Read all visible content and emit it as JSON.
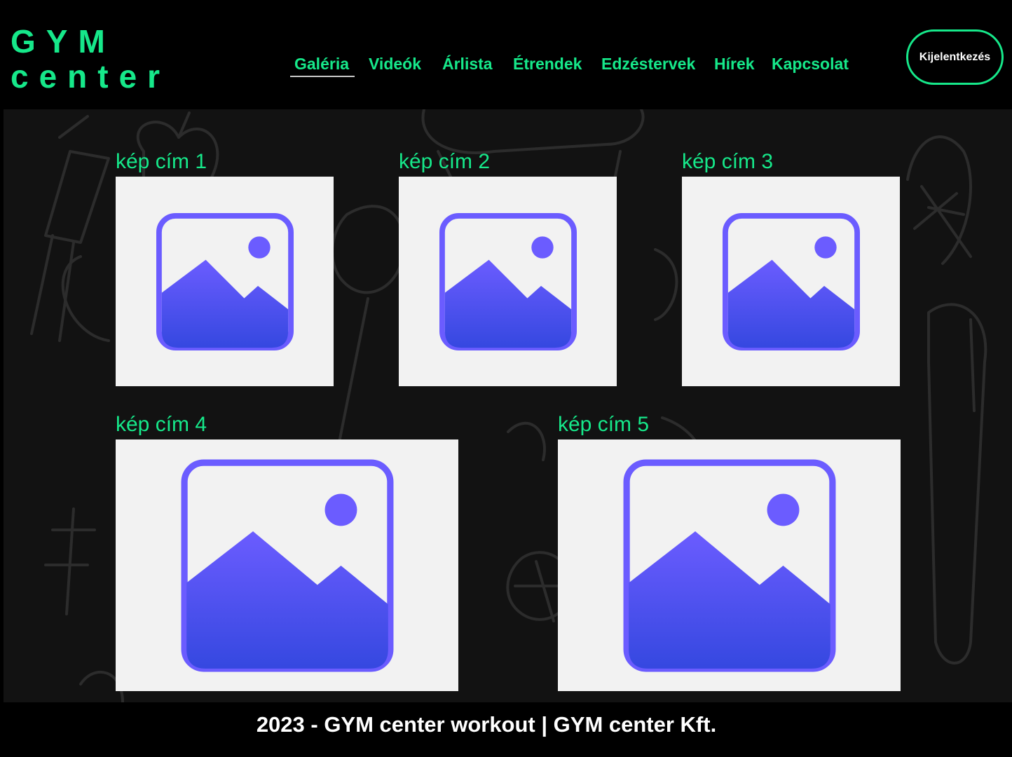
{
  "header": {
    "logo_line1": "GYM",
    "logo_line2": "center",
    "nav": [
      "Galéria",
      "Videók",
      "Árlista",
      "Étrendek",
      "Edzéstervek",
      "Hírek",
      "Kapcsolat"
    ],
    "active_nav": "Galéria",
    "logout_label": "Kijelentkezés"
  },
  "gallery": {
    "items": [
      {
        "title": "kép cím 1",
        "icon": "image-placeholder-icon"
      },
      {
        "title": "kép cím 2",
        "icon": "image-placeholder-icon"
      },
      {
        "title": "kép cím 3",
        "icon": "image-placeholder-icon"
      },
      {
        "title": "kép cím 4",
        "icon": "image-placeholder-icon"
      },
      {
        "title": "kép cím 5",
        "icon": "image-placeholder-icon"
      }
    ]
  },
  "footer": {
    "text": "2023 - GYM center workout | GYM center Kft."
  },
  "colors": {
    "accent": "#16e88a",
    "background": "#000000",
    "content_bg": "#121212",
    "card_bg": "#f2f2f2",
    "icon_top": "#6b5cff",
    "icon_bottom": "#3548e0"
  }
}
